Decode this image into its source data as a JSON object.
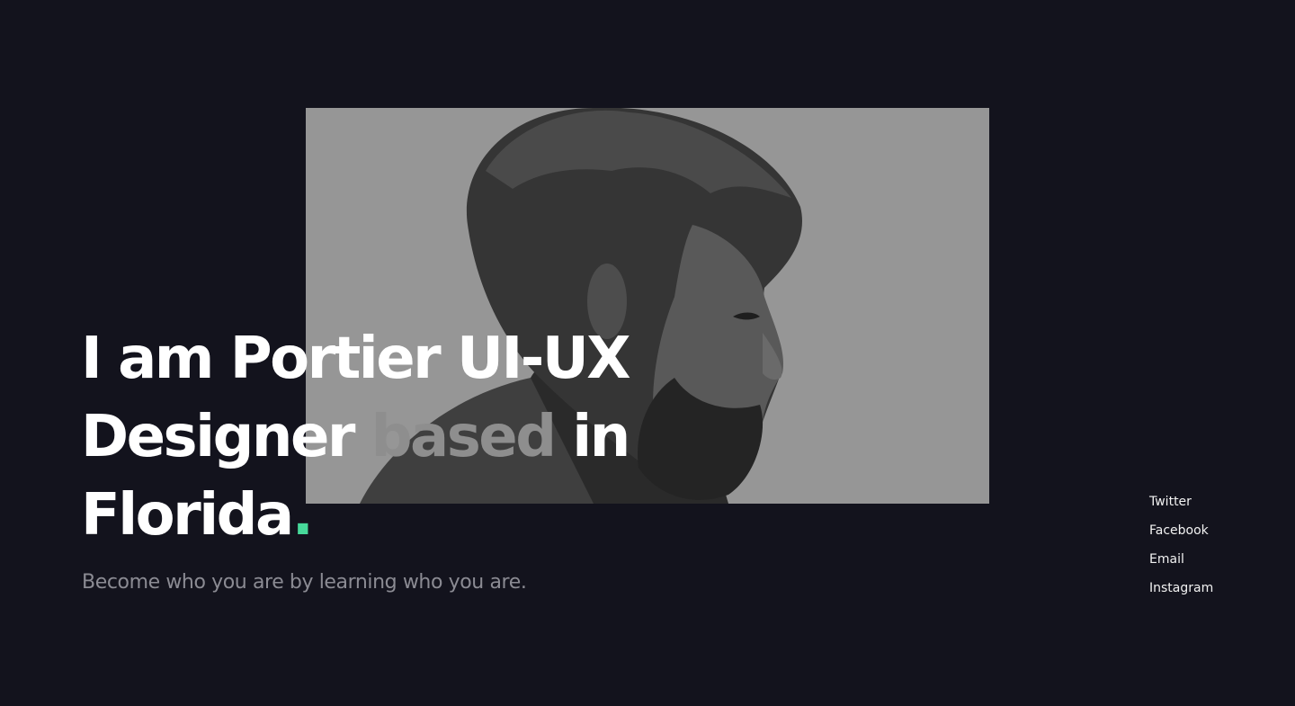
{
  "hero": {
    "photo_icon": "portrait-photo",
    "headline": {
      "line1": "I am Portier UI-UX",
      "line2_start": "Designer",
      "line2_muted": "based",
      "line2_end": "in",
      "line3": "Florida",
      "dot": "."
    },
    "tagline": "Become who you are by learning who you are."
  },
  "social": {
    "links": [
      {
        "label": "Twitter"
      },
      {
        "label": "Facebook"
      },
      {
        "label": "Email"
      },
      {
        "label": "Instagram"
      }
    ]
  },
  "colors": {
    "background": "#13131d",
    "text": "#ffffff",
    "muted_text": "#8e8e8e",
    "accent": "#47d99a"
  }
}
